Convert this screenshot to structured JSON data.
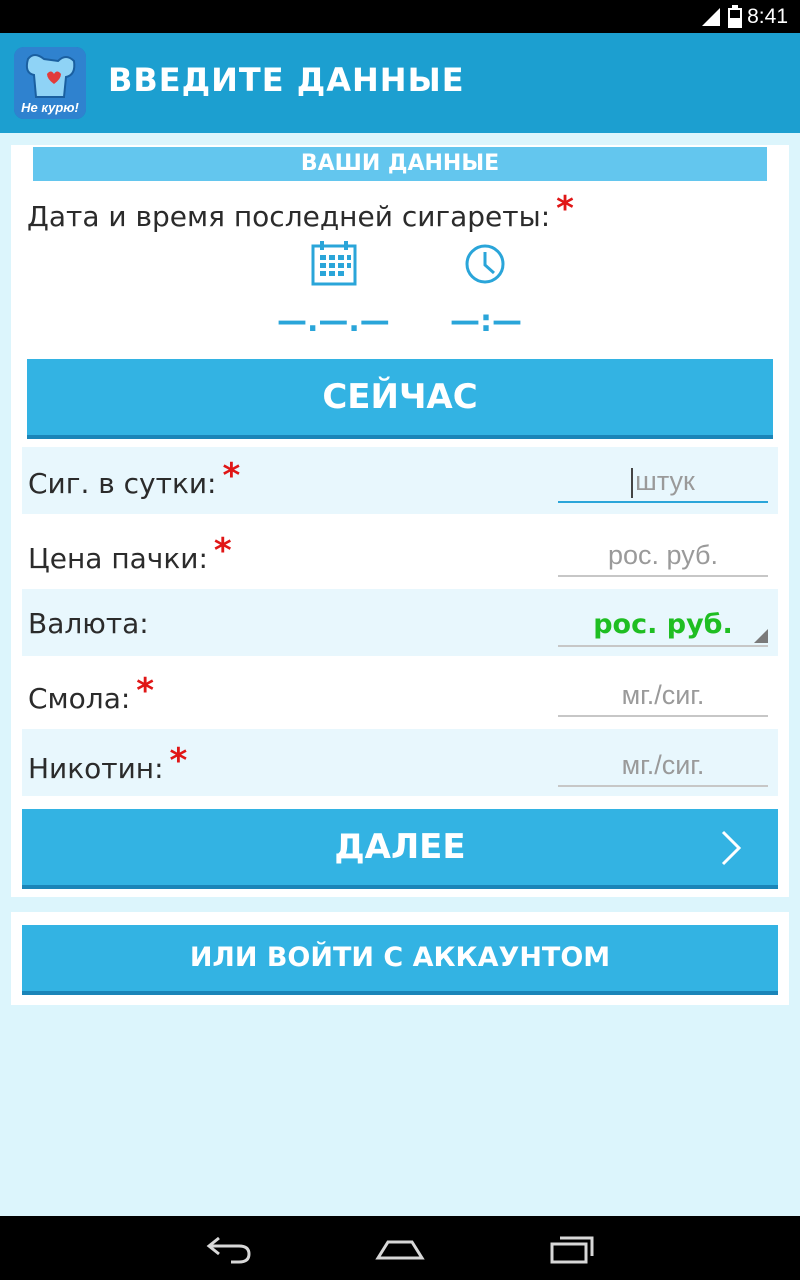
{
  "status_bar": {
    "time": "8:41",
    "network": "4G"
  },
  "action_bar": {
    "title": "ВВЕДИТЕ ДАННЫЕ",
    "logo_text": "Не курю!"
  },
  "section": {
    "header": "ВАШИ ДАННЫЕ"
  },
  "last_cigarette": {
    "label": "Дата и время последней сигареты:",
    "required_mark": "*",
    "date_placeholder": "—.—.—",
    "time_placeholder": "—:—"
  },
  "buttons": {
    "now": "СЕЙЧАС",
    "next": "ДАЛЕЕ",
    "login": "ИЛИ ВОЙТИ С АККАУНТОМ"
  },
  "fields": [
    {
      "label": "Сиг. в сутки:",
      "required": "*",
      "placeholder": "штук"
    },
    {
      "label": "Цена пачки:",
      "required": "*",
      "placeholder": "рос. руб."
    },
    {
      "label": "Валюта:",
      "value": "рос. руб."
    },
    {
      "label": "Смола:",
      "required": "*",
      "placeholder": "мг./сиг."
    },
    {
      "label": "Никотин:",
      "required": "*",
      "placeholder": "мг./сиг."
    }
  ],
  "colors": {
    "accent": "#33b3e3",
    "action_bar": "#1c9fd0",
    "background": "#dcf5fc",
    "required": "#e01616",
    "currency_value": "#1fbe22"
  },
  "icons": [
    "calendar-icon",
    "clock-icon",
    "chevron-right-icon",
    "back-icon",
    "home-icon",
    "recent-apps-icon"
  ]
}
